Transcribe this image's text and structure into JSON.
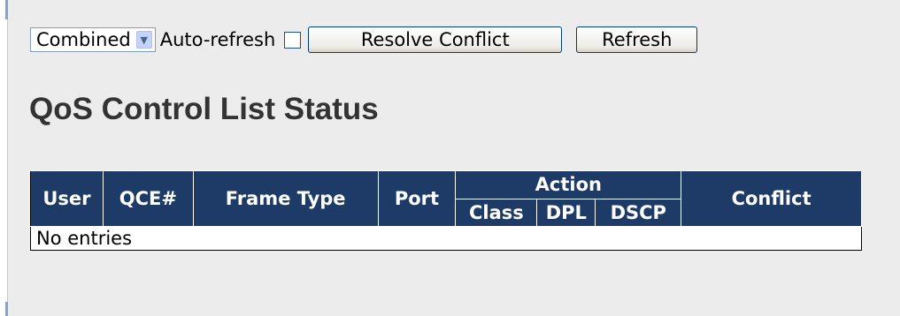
{
  "toolbar": {
    "view_select": {
      "value": "Combined"
    },
    "auto_refresh_label": "Auto-refresh",
    "auto_refresh_checked": false,
    "resolve_conflict_label": "Resolve Conflict",
    "refresh_label": "Refresh"
  },
  "page_title": "QoS Control List Status",
  "table": {
    "columns": {
      "user": "User",
      "qce": "QCE#",
      "frame_type": "Frame Type",
      "port": "Port",
      "action": "Action",
      "class": "Class",
      "dpl": "DPL",
      "dscp": "DSCP",
      "conflict": "Conflict"
    },
    "empty_message": "No entries"
  },
  "colors": {
    "header_bg": "#1e3a66",
    "page_bg": "#ececec",
    "title": "#333333"
  }
}
